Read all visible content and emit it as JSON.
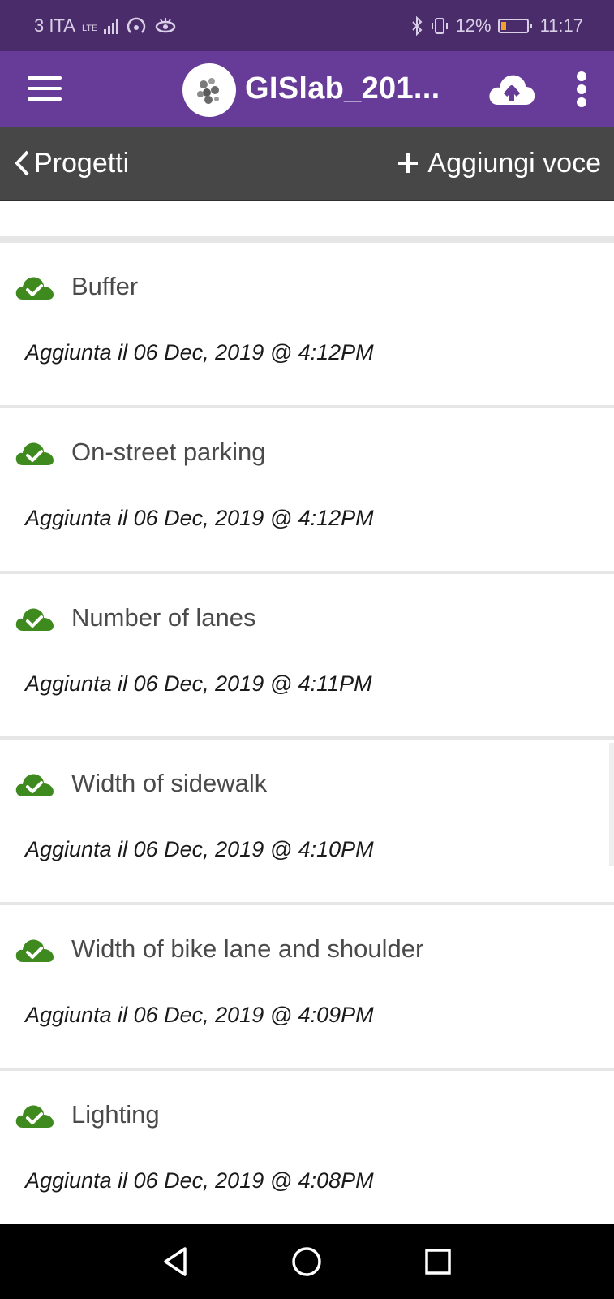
{
  "status_bar": {
    "carrier": "3 ITA",
    "network": "LTE",
    "battery": "12%",
    "time": "11:17",
    "battery_color": "#f0a030"
  },
  "app_bar": {
    "title": "GISlab_201...",
    "menu_icon": "hamburger-icon",
    "upload_icon": "cloud-upload-icon",
    "more_icon": "more-vertical-icon",
    "background": "#673c98"
  },
  "nav_bar": {
    "back_label": "Progetti",
    "add_label": "Aggiungi voce",
    "background": "#474747"
  },
  "items": [
    {
      "title": "Buffer",
      "date": "Aggiunta il 06 Dec, 2019 @ 4:12PM",
      "status_icon": "cloud-check-icon"
    },
    {
      "title": "On-street parking",
      "date": "Aggiunta il 06 Dec, 2019 @ 4:12PM",
      "status_icon": "cloud-check-icon"
    },
    {
      "title": "Number of lanes",
      "date": "Aggiunta il 06 Dec, 2019 @ 4:11PM",
      "status_icon": "cloud-check-icon"
    },
    {
      "title": "Width of sidewalk",
      "date": "Aggiunta il 06 Dec, 2019 @ 4:10PM",
      "status_icon": "cloud-check-icon"
    },
    {
      "title": "Width of bike lane and shoulder",
      "date": "Aggiunta il 06 Dec, 2019 @ 4:09PM",
      "status_icon": "cloud-check-icon"
    },
    {
      "title": "Lighting",
      "date": "Aggiunta il 06 Dec, 2019 @ 4:08PM",
      "status_icon": "cloud-check-icon"
    }
  ],
  "colors": {
    "synced_green": "#3f8a1e"
  },
  "system_nav": {
    "back_icon": "triangle-back-icon",
    "home_icon": "circle-home-icon",
    "recents_icon": "square-recents-icon"
  }
}
